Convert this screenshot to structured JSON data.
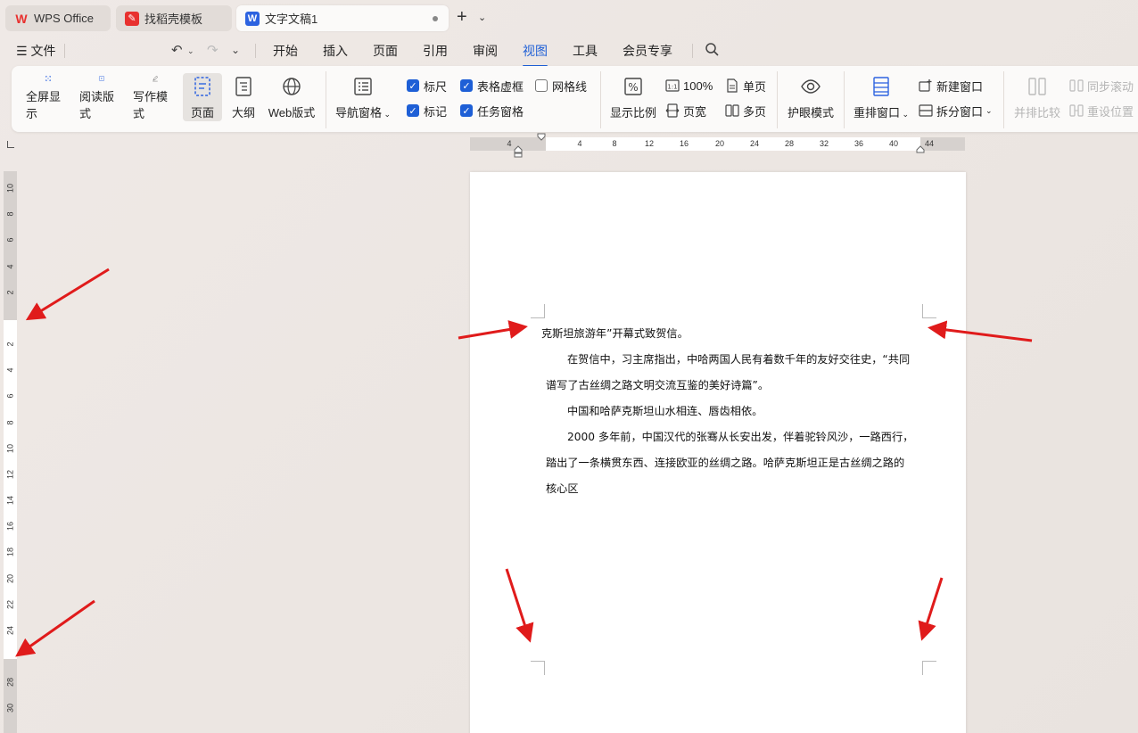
{
  "tabs": [
    {
      "label": "WPS Office",
      "icon": "wps-logo-icon"
    },
    {
      "label": "找稻壳模板",
      "icon": "docer-icon"
    },
    {
      "label": "文字文稿1",
      "icon": "writer-doc-icon",
      "active": true
    }
  ],
  "menu": {
    "file": "文件",
    "items": [
      "开始",
      "插入",
      "页面",
      "引用",
      "审阅",
      "视图",
      "工具",
      "会员专享"
    ],
    "active": "视图"
  },
  "ribbon": {
    "fullscreen": "全屏显示",
    "reading": "阅读版式",
    "writing": "写作模式",
    "page": "页面",
    "outline": "大纲",
    "web": "Web版式",
    "nav_pane": "导航窗格",
    "ruler": "标尺",
    "table_gridlines": "表格虚框",
    "gridlines": "网格线",
    "marks": "标记",
    "task_pane": "任务窗格",
    "zoom": "显示比例",
    "zoom100": "100%",
    "page_width": "页宽",
    "single_page": "单页",
    "multi_page": "多页",
    "eye_mode": "护眼模式",
    "arrange": "重排窗口",
    "new_window": "新建窗口",
    "split": "拆分窗口",
    "side_by_side": "并排比较",
    "sync_scroll": "同步滚动",
    "reset_pos": "重设位置"
  },
  "checkbox_states": {
    "ruler": true,
    "table_gridlines": true,
    "gridlines": false,
    "marks": true,
    "task_pane": true
  },
  "hruler": {
    "labels": [
      "4",
      "4",
      "8",
      "12",
      "16",
      "20",
      "24",
      "28",
      "32",
      "36",
      "40",
      "44"
    ]
  },
  "vruler": {
    "labels": [
      "10",
      "8",
      "6",
      "4",
      "2",
      "2",
      "4",
      "6",
      "8",
      "10",
      "12",
      "14",
      "16",
      "18",
      "20",
      "22",
      "24",
      "28",
      "30"
    ]
  },
  "document": {
    "lines": [
      "克斯坦旅游年”开幕式致贺信。",
      "在贺信中，习主席指出，中哈两国人民有着数千年的友好交往史，“共同",
      "谱写了古丝绸之路文明交流互鉴的美好诗篇”。",
      "中国和哈萨克斯坦山水相连、唇齿相依。",
      "2000 多年前，中国汉代的张骞从长安出发，伴着驼铃风沙，一路西行，",
      "踏出了一条横贯东西、连接欧亚的丝绸之路。哈萨克斯坦正是古丝绸之路的",
      "核心区"
    ]
  },
  "colors": {
    "accent": "#1e5fd6",
    "arrow": "#e01b1b",
    "wps_red": "#e8312f"
  }
}
